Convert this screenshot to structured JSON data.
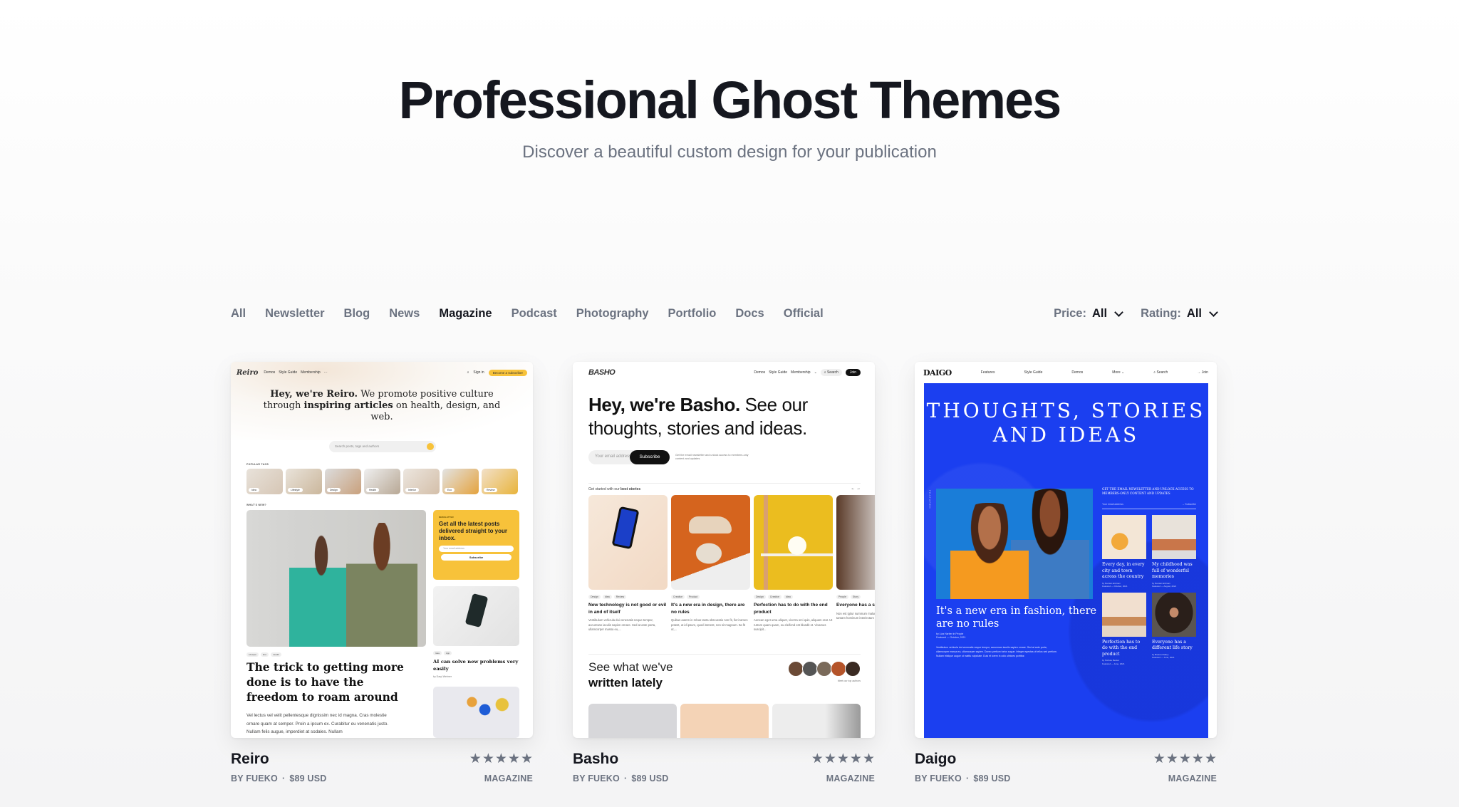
{
  "hero": {
    "title": "Professional Ghost Themes",
    "subtitle": "Discover a beautiful custom design for your publication"
  },
  "filters": {
    "tabs": [
      {
        "label": "All",
        "active": false
      },
      {
        "label": "Newsletter",
        "active": false
      },
      {
        "label": "Blog",
        "active": false
      },
      {
        "label": "News",
        "active": false
      },
      {
        "label": "Magazine",
        "active": true
      },
      {
        "label": "Podcast",
        "active": false
      },
      {
        "label": "Photography",
        "active": false
      },
      {
        "label": "Portfolio",
        "active": false
      },
      {
        "label": "Docs",
        "active": false
      },
      {
        "label": "Official",
        "active": false
      }
    ],
    "price": {
      "label": "Price:",
      "value": "All",
      "icon": "chevron-down-icon"
    },
    "rating": {
      "label": "Rating:",
      "value": "All",
      "icon": "chevron-down-icon"
    }
  },
  "themes": [
    {
      "name": "Reiro",
      "author": "BY FUEKO",
      "price": "$89 USD",
      "category": "MAGAZINE",
      "rating": 5,
      "rating_max": 5,
      "preview": {
        "logo": "Reiro",
        "nav": [
          "Demos",
          "Style Guide",
          "Membership",
          "···"
        ],
        "signin": "Sign in",
        "cta": "Become a subscriber",
        "headline_bold": "Hey, we're Reiro.",
        "headline_1": " We promote positive culture through ",
        "headline_bold2": "inspiring articles",
        "headline_2": " on health, design, and web.",
        "search_placeholder": "Search posts, tags and authors",
        "popular_tags_label": "POPULAR TAGS",
        "popular_tags": [
          "Idea",
          "Lifestyle",
          "Design",
          "Health",
          "Interior",
          "Eco",
          "Review"
        ],
        "whats_new_label": "WHAT'S NEW?",
        "newsletter_kicker": "NEWSLETTER",
        "newsletter_title": "Get all the latest posts delivered straight to your inbox.",
        "newsletter_placeholder": "Your email address",
        "newsletter_button": "Subscribe",
        "main_tags": [
          "Lifestyle",
          "Eco",
          "Health"
        ],
        "main_title": "The trick to getting more done is to have the freedom to roam around",
        "main_excerpt": "Vel lectus vel velit pellentesque dignissim nec id magna. Cras molestie ornare quam at semper. Proin a ipsum ex. Curabitur eu venenatis justo. Nullam felis augue, imperdiet at sodales. Nullam",
        "side_tags": [
          "Idea",
          "App"
        ],
        "side_title": "AI can solve new problems very easily",
        "side_by": "by Daryl Wehner"
      }
    },
    {
      "name": "Basho",
      "author": "BY FUEKO",
      "price": "$89 USD",
      "category": "MAGAZINE",
      "rating": 5,
      "rating_max": 5,
      "preview": {
        "logo": "BASHO",
        "nav": [
          "Demos",
          "Style Guide",
          "Membership"
        ],
        "search": "Search",
        "join": "Join",
        "headline_bold": "Hey, we're Basho.",
        "headline_rest": " See our thoughts, stories and ideas.",
        "email_placeholder": "Your email address",
        "subscribe": "Subscribe",
        "note": "Get the email newsletter and unlock access to members-only content and updates",
        "section": "Get started with our",
        "section_bold": "best stories",
        "stories": [
          {
            "tags": [
              "Design",
              "Idea",
              "Review"
            ],
            "title": "New technology is not good or evil in and of itself",
            "excerpt": "Vestibulum vehicula dui venenatis neque tempor, accumsan iaculis sapien ornare. Sed at ante porta, ullamcorper massa eu,..."
          },
          {
            "tags": [
              "Creative",
              "Product"
            ],
            "title": "It's a new era in design, there are no rules",
            "excerpt": "Quibus autem in rebus tanta obscuratio non fit, fieri tamen potest, ut id ipsum, quod interest, non sit magnum. Ita fit ut,..."
          },
          {
            "tags": [
              "Design",
              "Creative",
              "Idea"
            ],
            "title": "Perfection has to do with the end product",
            "excerpt": "Aenean eget urna aliquet, viverra orci quis, aliquam erat. Ut rutrum quam quam, eu eleifend est blandit et. Vivamus suscipit..."
          },
          {
            "tags": [
              "People",
              "Story"
            ],
            "title": "Everyone has a story",
            "excerpt": "Non est igitur summum malum dolor autem inter haec tantam hominum interiectam non"
          }
        ],
        "lately_1": "See what we've",
        "lately_2": "written lately",
        "meet": "Meet our top authors"
      }
    },
    {
      "name": "Daigo",
      "author": "BY FUEKO",
      "price": "$89 USD",
      "category": "MAGAZINE",
      "rating": 5,
      "rating_max": 5,
      "preview": {
        "logo": "DAIGO",
        "nav": [
          "Features",
          "Style Guide",
          "Demos",
          "More ⌄",
          "⌕ Search",
          "→ Join"
        ],
        "headline": "THOUGHTS, STORIES AND IDEAS",
        "featured_label": "FEATURED",
        "main_title": "It's a new era in fashion, there are no rules",
        "main_by": "by Liza Harber in People",
        "main_date": "Featured — October, 2021",
        "main_excerpt": "Vestibulum vehicula dui venenatis neque tempor, accumsan iaculis sapien ornare. Sed at ante porta, ullamcorper massa eu, ullamcorper sapien. Donec pretium tortor augue. Integer egestas ut tellus sed pretium. Nullam tristique augue ut mattis vulputate. Duis et lorem in odio ultricies porttitor.",
        "newsletter": "GET THE EMAIL NEWSLETTER AND UNLOCK ACCESS TO MEMBERS-ONLY CONTENT AND UPDATES",
        "email_placeholder": "Your email address",
        "subscribe": "→ Subscribe",
        "grid": [
          {
            "title": "Every day, in every city and town across the country",
            "by": "by Damian Erdman",
            "date": "Featured — October, 2021"
          },
          {
            "title": "My childhood was full of wonderful memories",
            "by": "by Damian Erdman",
            "date": "Featured — August, 2021"
          },
          {
            "title": "Perfection has to do with the end product",
            "by": "by Nichole Becker",
            "date": "Featured — June, 2021"
          },
          {
            "title": "Everyone has a different life story",
            "by": "by Breana Flatley",
            "date": "Featured — June, 2021"
          }
        ]
      }
    }
  ],
  "colors": {
    "heading": "#15171f",
    "muted": "#6b7280",
    "reiro_accent": "#f7c23a",
    "daigo_blue": "#1b3ff0"
  }
}
